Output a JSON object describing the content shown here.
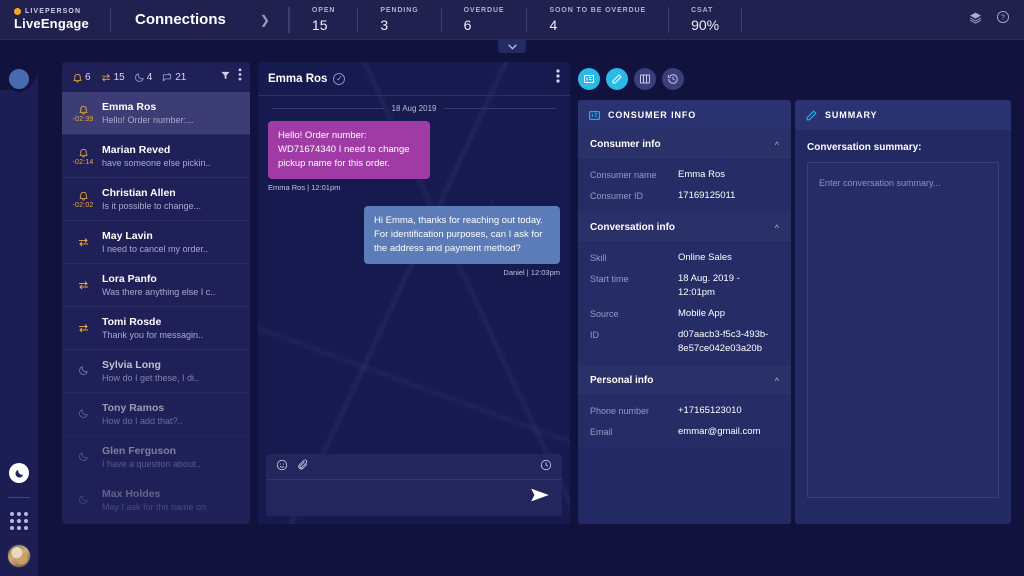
{
  "header": {
    "brand_name": "LIVEPERSON",
    "brand_product": "LiveEngage",
    "nav_label": "Connections",
    "stats": [
      {
        "label": "OPEN",
        "value": "15"
      },
      {
        "label": "PENDING",
        "value": "3"
      },
      {
        "label": "OVERDUE",
        "value": "6"
      },
      {
        "label": "SOON TO BE OVERDUE",
        "value": "4"
      },
      {
        "label": "CSAT",
        "value": "90%"
      }
    ]
  },
  "conversation_list": {
    "filters": [
      {
        "icon": "bell-icon",
        "count": "6"
      },
      {
        "icon": "transfer-icon",
        "count": "15"
      },
      {
        "icon": "moon-icon",
        "count": "4"
      },
      {
        "icon": "muted-chat-icon",
        "count": "21"
      }
    ],
    "items": [
      {
        "name": "Emma Ros",
        "preview": "Hello! Order number:...",
        "time": "-02:39",
        "icon": "bell-icon"
      },
      {
        "name": "Marian Reved",
        "preview": "have someone else pickin..",
        "time": "-02:14",
        "icon": "bell-icon"
      },
      {
        "name": "Christian Allen",
        "preview": "Is it possible to change...",
        "time": "-02:02",
        "icon": "bell-icon"
      },
      {
        "name": "May Lavin",
        "preview": "I need to cancel my order..",
        "time": "",
        "icon": "transfer-icon"
      },
      {
        "name": "Lora Panfo",
        "preview": "Was there anything else I c..",
        "time": "",
        "icon": "transfer-icon"
      },
      {
        "name": "Tomi Rosde",
        "preview": "Thank you for messagin..",
        "time": "",
        "icon": "transfer-icon"
      },
      {
        "name": "Sylvia Long",
        "preview": "How do I get these, I di..",
        "time": "",
        "icon": "moon-icon"
      },
      {
        "name": "Tony Ramos",
        "preview": "How do I add that?..",
        "time": "",
        "icon": "moon-icon"
      },
      {
        "name": "Glen Ferguson",
        "preview": "I have a question about..",
        "time": "",
        "icon": "moon-icon"
      },
      {
        "name": "Max Holdes",
        "preview": "May I ask for the name on",
        "time": "",
        "icon": "moon-icon"
      }
    ]
  },
  "chat": {
    "title": "Emma Ros",
    "date_divider": "18 Aug 2019",
    "messages": [
      {
        "text": "Hello! Order number: WD71674340 I need to change pickup name for this order.",
        "meta": "Emma Ros | 12:01pm",
        "direction": "inbound"
      },
      {
        "text": "Hi Emma, thanks for reaching out today. For identification purposes, can I ask for the address and payment method?",
        "meta": "Daniel | 12:03pm",
        "direction": "outbound"
      }
    ],
    "composer_placeholder": ""
  },
  "consumer_panel": {
    "header_title": "CONSUMER INFO",
    "sections": [
      {
        "title": "Consumer info",
        "rows": [
          {
            "key": "Consumer name",
            "value": "Emma Ros"
          },
          {
            "key": "Consumer ID",
            "value": "17169125011"
          }
        ]
      },
      {
        "title": "Conversation info",
        "rows": [
          {
            "key": "Skill",
            "value": "Online Sales"
          },
          {
            "key": "Start time",
            "value": "18 Aug. 2019 - 12:01pm"
          },
          {
            "key": "Source",
            "value": "Mobile App"
          },
          {
            "key": "ID",
            "value": "d07aacb3-f5c3-493b-8e57ce042e03a20b"
          }
        ]
      },
      {
        "title": "Personal info",
        "rows": [
          {
            "key": "Phone number",
            "value": "+17165123010"
          },
          {
            "key": "Email",
            "value": "emmar@gmail.com"
          }
        ]
      }
    ]
  },
  "summary_panel": {
    "header_title": "SUMMARY",
    "label": "Conversation summary:",
    "placeholder": "Enter conversation summary..."
  },
  "colors": {
    "accent_cyan": "#2bb9e8",
    "inbound_bubble": "#a03ba6",
    "outbound_bubble": "#5c7cb8",
    "alert_orange": "#f0a93c"
  }
}
